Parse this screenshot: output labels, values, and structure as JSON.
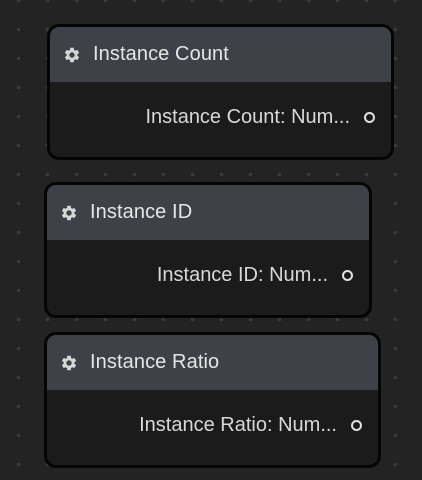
{
  "nodes": [
    {
      "title": "Instance Count",
      "output_label": "Instance Count: Num...",
      "icon": "gear-icon"
    },
    {
      "title": "Instance ID",
      "output_label": "Instance ID: Num...",
      "icon": "gear-icon"
    },
    {
      "title": "Instance Ratio",
      "output_label": "Instance Ratio: Num...",
      "icon": "gear-icon"
    }
  ],
  "colors": {
    "canvas": "#232323",
    "node_header": "#3e4248",
    "node_body": "#1b1b1b",
    "text": "#e6e6e6"
  }
}
